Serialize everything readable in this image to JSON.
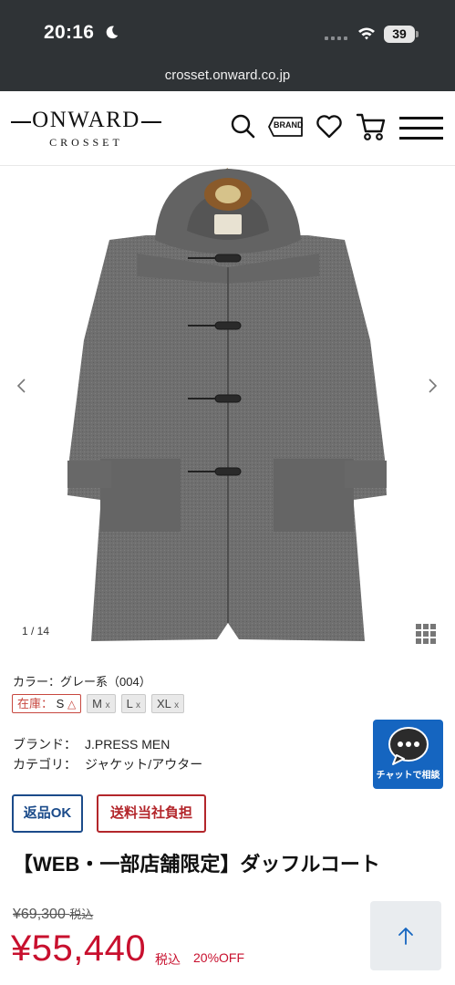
{
  "status_bar": {
    "time": "20:16",
    "battery": "39"
  },
  "browser": {
    "url": "crosset.onward.co.jp"
  },
  "header": {
    "logo_main": "ONWARD",
    "logo_sub": "CROSSET",
    "brand_label": "BRAND",
    "icons": [
      "search-icon",
      "brand-tag-icon",
      "heart-icon",
      "cart-icon",
      "hamburger-menu-icon"
    ]
  },
  "gallery": {
    "counter": "1 / 14",
    "current": 1,
    "total": 14
  },
  "product": {
    "color": "カラー：グレー系（004）",
    "sizes": [
      {
        "stock_label": "在庫：",
        "size": "S",
        "mark": "△",
        "available": true
      },
      {
        "size": "M",
        "mark": "x",
        "available": false
      },
      {
        "size": "L",
        "mark": "x",
        "available": false
      },
      {
        "size": "XL",
        "mark": "x",
        "available": false
      }
    ],
    "brand_label": "ブランド：",
    "brand_value": "J.PRESS MEN",
    "category_label": "カテゴリ：",
    "category_value": "ジャケット/アウター",
    "badge_return": "返品OK",
    "badge_shipping": "送料当社負担",
    "title": "【WEB・一部店舗限定】ダッフルコート",
    "original_price": "¥69,300",
    "original_tax": "税込",
    "sale_price": "¥55,440",
    "sale_tax": "税込",
    "discount": "20%OFF"
  },
  "chat": {
    "label": "チャットで相談"
  },
  "colors": {
    "sale_red": "#c8102e",
    "return_blue": "#1b4b8a",
    "shipping_red": "#b3262b",
    "chat_blue": "#1565c0",
    "browser_dark": "#2f3336"
  }
}
